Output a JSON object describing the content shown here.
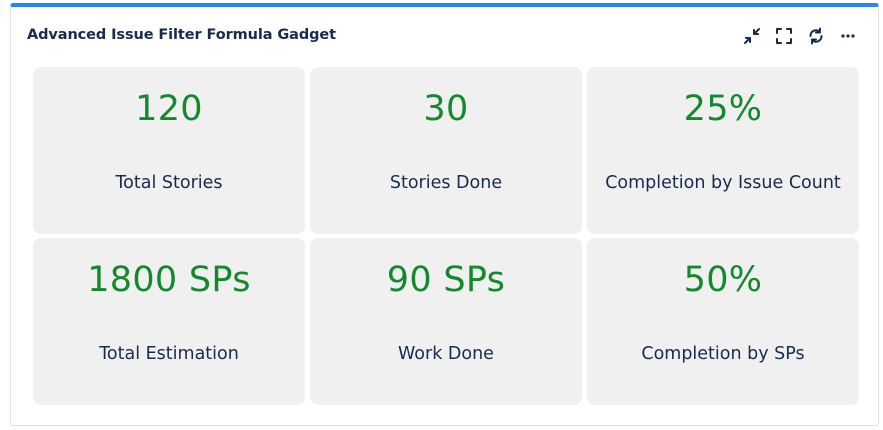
{
  "gadget": {
    "title": "Advanced Issue Filter Formula Gadget",
    "controls": [
      {
        "name": "minimize-icon"
      },
      {
        "name": "fullscreen-icon"
      },
      {
        "name": "refresh-icon"
      },
      {
        "name": "more-options-icon"
      }
    ]
  },
  "metrics": [
    {
      "value": "120",
      "label": "Total Stories"
    },
    {
      "value": "30",
      "label": "Stories Done"
    },
    {
      "value": "25%",
      "label": "Completion by Issue Count"
    },
    {
      "value": "1800 SPs",
      "label": "Total Estimation"
    },
    {
      "value": "90 SPs",
      "label": "Work Done"
    },
    {
      "value": "50%",
      "label": "Completion by SPs"
    }
  ],
  "colors": {
    "accent_bar": "#2684ff",
    "value_text": "#128a2c",
    "label_text": "#172b4d",
    "card_bg": "#f0f0f0"
  }
}
